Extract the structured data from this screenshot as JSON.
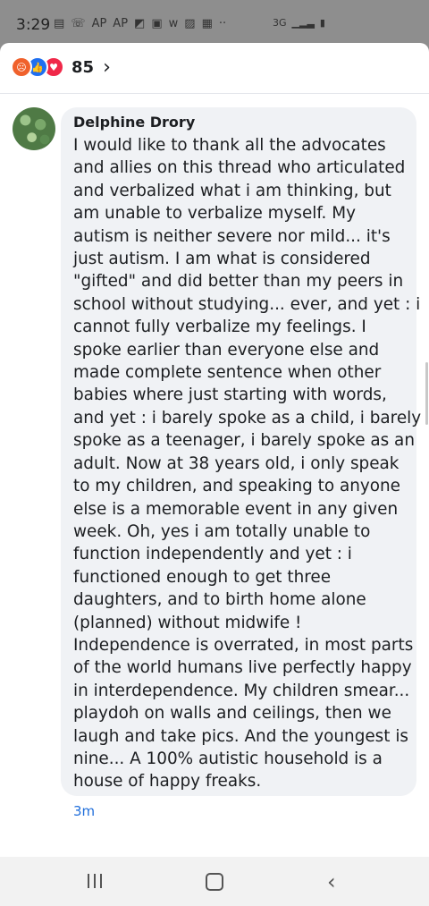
{
  "status_bar": {
    "time": "3:29",
    "icons": [
      "message-icon",
      "wifi-call-icon",
      "ap-news-icon",
      "ap-news-icon",
      "photos-icon",
      "tv-icon",
      "w-app-icon",
      "gallery-icon",
      "window-icon",
      "more-dots-icon"
    ],
    "network": "3G",
    "ap_label": "AP"
  },
  "reactions": {
    "types": [
      "angry",
      "like",
      "love"
    ],
    "count": "85",
    "colors": {
      "angry": "#f0612c",
      "like": "#1f6ff0",
      "love": "#f02849"
    }
  },
  "comment": {
    "author": "Delphine Drory",
    "lines": [
      "I would like to thank all the advocates",
      "and allies on this thread who articulated",
      "and verbalized what i am thinking, but",
      "am unable to verbalize myself. My",
      "autism is neither severe nor mild... it's",
      "just autism. I am what is considered",
      "\"gifted\" and did better than my peers in",
      "school without studying... ever, and yet : i",
      "cannot fully verbalize my feelings. I",
      "spoke earlier than everyone else and",
      "made complete sentence when other",
      "babies where just starting with words,",
      "and yet : i barely spoke as a child, i barely",
      "spoke as a teenager, i barely spoke as an",
      "adult. Now at 38 years old, i only speak",
      "to my children, and speaking to anyone",
      "else is a memorable event in any given",
      "week. Oh, yes i am totally unable to",
      "function independently and yet : i",
      "functioned enough to get three",
      "daughters, and to birth home alone",
      "(planned) without midwife !",
      "Independence is overrated, in most parts",
      "of the world humans live perfectly happy",
      "in interdependence. My children smear...",
      "playdoh on walls and ceilings, then we",
      "laugh and take pics. And the youngest is",
      "nine... A 100% autistic household is a",
      "house of happy freaks."
    ],
    "time": "3m"
  },
  "nav_bar": {
    "buttons": [
      "recent-apps",
      "home",
      "back"
    ]
  }
}
